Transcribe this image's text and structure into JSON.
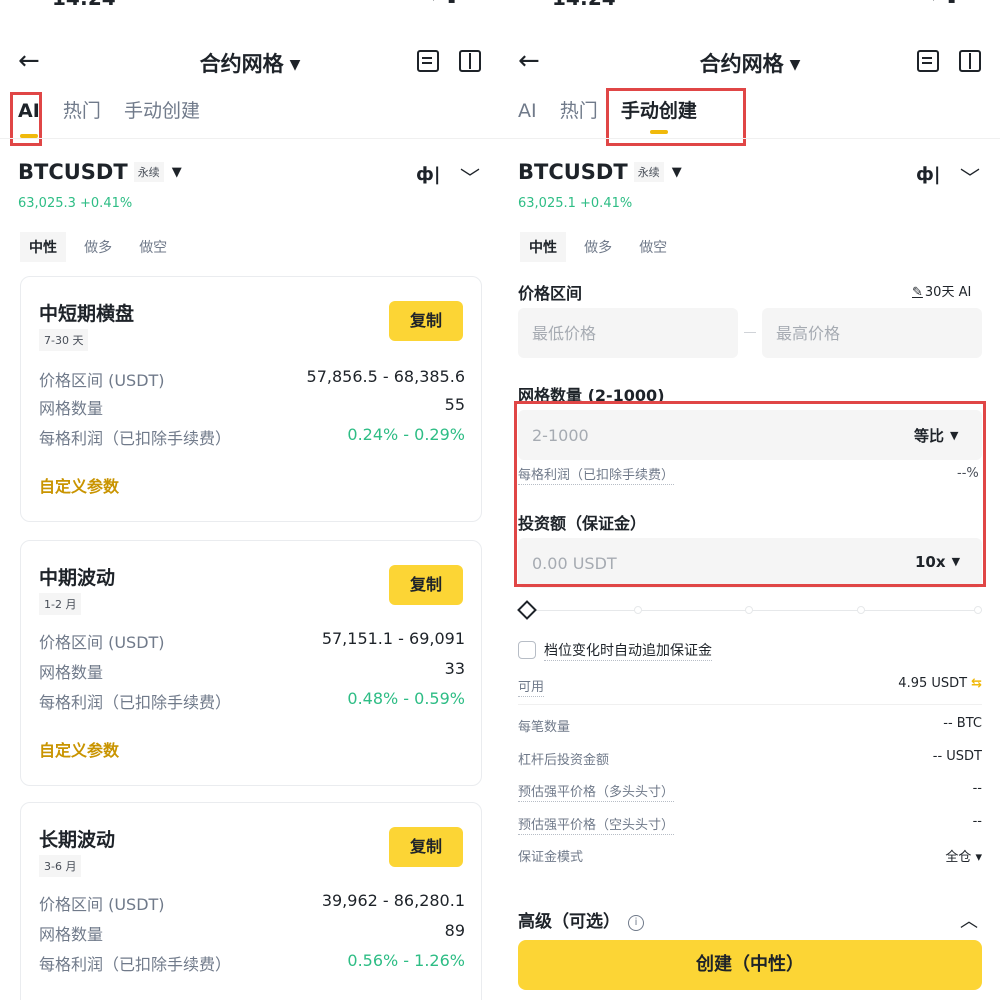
{
  "status": {
    "time": "14:24",
    "right_symbols": "···· ▾ ▮"
  },
  "header": {
    "title": "合约网格",
    "back_icon": "←"
  },
  "tabs": [
    "AI",
    "热门",
    "手动创建"
  ],
  "pair": {
    "symbol": "BTCUSDT",
    "tag": "永续"
  },
  "left": {
    "price": "63,025.3 +0.41%",
    "modes": [
      "中性",
      "做多",
      "做空"
    ],
    "cards": [
      {
        "title": "中短期横盘",
        "tag": "7-30 天",
        "copy": "复制",
        "rows": [
          {
            "label": "价格区间 (USDT)",
            "value": "57,856.5 - 68,385.6"
          },
          {
            "label": "网格数量",
            "value": "55"
          },
          {
            "label": "每格利润（已扣除手续费）",
            "value": "0.24% - 0.29%"
          }
        ],
        "custom": "自定义参数"
      },
      {
        "title": "中期波动",
        "tag": "1-2 月",
        "copy": "复制",
        "rows": [
          {
            "label": "价格区间 (USDT)",
            "value": "57,151.1 - 69,091"
          },
          {
            "label": "网格数量",
            "value": "33"
          },
          {
            "label": "每格利润（已扣除手续费）",
            "value": "0.48% - 0.59%"
          }
        ],
        "custom": "自定义参数"
      },
      {
        "title": "长期波动",
        "tag": "3-6 月",
        "copy": "复制",
        "rows": [
          {
            "label": "价格区间 (USDT)",
            "value": "39,962 - 86,280.1"
          },
          {
            "label": "网格数量",
            "value": "89"
          },
          {
            "label": "每格利润（已扣除手续费）",
            "value": "0.56% - 1.26%"
          }
        ]
      }
    ]
  },
  "right": {
    "price": "63,025.1 +0.41%",
    "modes": [
      "中性",
      "做多",
      "做空"
    ],
    "price_range": {
      "label": "价格区间",
      "ai_label": "30天 AI",
      "min_placeholder": "最低价格",
      "max_placeholder": "最高价格"
    },
    "grid": {
      "label": "网格数量 (2-1000)",
      "placeholder": "2-1000",
      "type": "等比"
    },
    "profit": {
      "label": "每格利润（已扣除手续费）",
      "value": "--%"
    },
    "invest": {
      "label": "投资额（保证金）",
      "placeholder": "0.00 USDT",
      "leverage": "10x"
    },
    "slider_value": 0,
    "auto_margin": "档位变化时自动追加保证金",
    "available": {
      "label": "可用",
      "value": "4.95 USDT"
    },
    "details": [
      {
        "label": "每笔数量",
        "value": "-- BTC"
      },
      {
        "label": "杠杆后投资金额",
        "value": "-- USDT"
      },
      {
        "label": "预估强平价格（多头头寸）",
        "value": "--"
      },
      {
        "label": "预估强平价格（空头头寸）",
        "value": "--"
      },
      {
        "label": "保证金模式",
        "value": "全仓 ▾"
      }
    ],
    "advanced": "高级（可选）",
    "create_button": "创建（中性）"
  },
  "colors": {
    "accent": "#fcd535",
    "green": "#2ebd85",
    "highlight": "#e04646",
    "gold_text": "#c99400"
  }
}
